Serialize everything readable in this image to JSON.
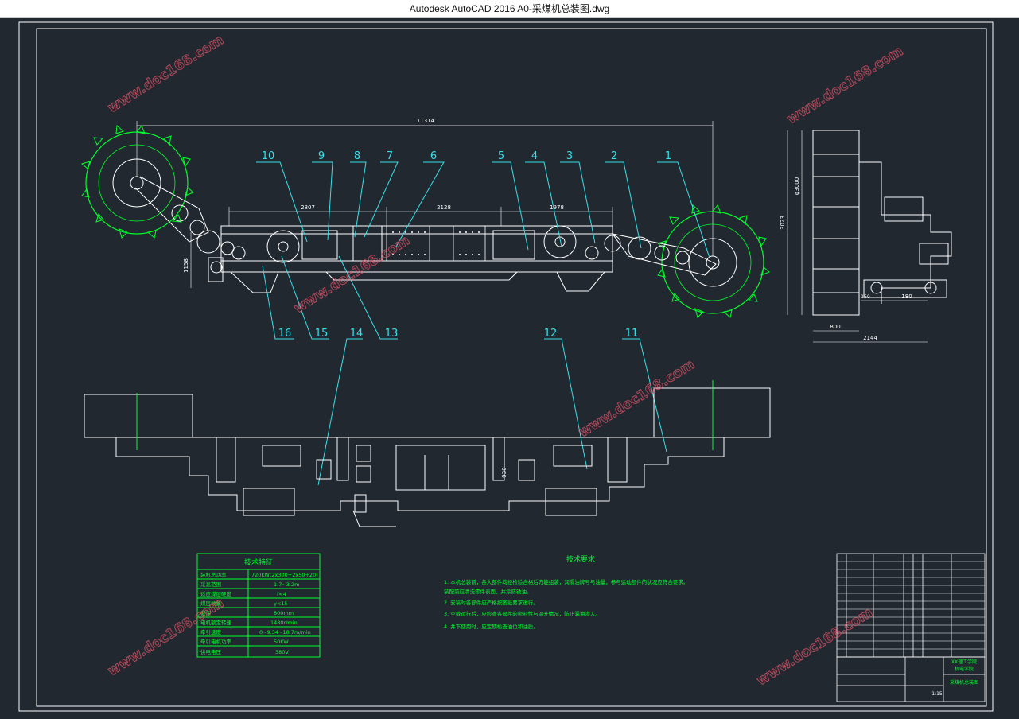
{
  "window": {
    "title": "Autodesk AutoCAD 2016     A0-采煤机总装图.dwg"
  },
  "drawing": {
    "line_color": "#ffffff",
    "accent_green": "#00ff2a",
    "accent_cyan": "#35e0e8",
    "background": "#212830",
    "overall_length_dim": "11314",
    "dims_top": [
      "2807",
      "2128",
      "1978"
    ],
    "dim_height_left": "1158",
    "side_view_dims": {
      "diameter": "φ3000",
      "height": "3023",
      "width": "2144",
      "bottom_a": "800",
      "bottom_b": "180",
      "small_a": "150"
    },
    "part_numbers_top": [
      "10",
      "9",
      "8",
      "7",
      "6",
      "5",
      "4",
      "3",
      "2",
      "1"
    ],
    "part_numbers_bottom": [
      "16",
      "15",
      "14",
      "13",
      "12",
      "11"
    ],
    "plan_view_dim": "930"
  },
  "tech_table": {
    "title": "技术特征",
    "rows": [
      {
        "label": "装机总功率",
        "value": "720KW(2x300+2x50+20)"
      },
      {
        "label": "采高范围",
        "value": "1.7~3.2m"
      },
      {
        "label": "适应煤层硬度",
        "value": "f<4"
      },
      {
        "label": "煤层倾角",
        "value": "γ<15"
      },
      {
        "label": "截深",
        "value": "800mm"
      },
      {
        "label": "电机额定转速",
        "value": "1480r/min"
      },
      {
        "label": "牵引速度",
        "value": "0~9.34~18.7m/min"
      },
      {
        "label": "牵引电机功率",
        "value": "50KW"
      },
      {
        "label": "供电电压",
        "value": "380V"
      }
    ]
  },
  "requirements": {
    "title": "技术要求",
    "items": [
      "1. 本机总装前，各大部件均经检验合格后方能组装，润滑油牌号与油量，参与运动部件的状况应符合要求。",
      "   装配前应清洗零件表面，并涂防锈油。",
      "2. 安装时各部件应严格按图纸要求进行。",
      "3. 空载运行后，应检查各部件的密封性与温升情况，防止漏油渗入。",
      "4. 井下使用时，应定期检查油位和油质。"
    ]
  },
  "title_block": {
    "school": "XX理工学院",
    "dept": "机电学院",
    "drawing_name": "采煤机总装图",
    "scale": "1:15"
  },
  "watermark": "www.doc168.com"
}
